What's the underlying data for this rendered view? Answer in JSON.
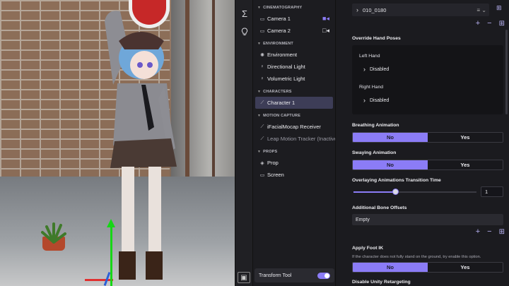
{
  "hierarchy": {
    "sections": [
      {
        "title": "CINEMATOGRAPHY",
        "items": [
          {
            "label": "Camera 1",
            "icon": "camera-icon",
            "right_icon": "video-active-icon"
          },
          {
            "label": "Camera 2",
            "icon": "camera-icon",
            "right_icon": "video-inactive-icon"
          }
        ]
      },
      {
        "title": "ENVIRONMENT",
        "items": [
          {
            "label": "Environment",
            "icon": "gear-icon"
          },
          {
            "label": "Directional Light",
            "icon": "bulb-icon"
          },
          {
            "label": "Volumetric Light",
            "icon": "bulb-icon"
          }
        ]
      },
      {
        "title": "CHARACTERS",
        "items": [
          {
            "label": "Character 1",
            "icon": "person-icon",
            "selected": true
          }
        ]
      },
      {
        "title": "MOTION CAPTURE",
        "items": [
          {
            "label": "iFacialMocap Receiver",
            "icon": "mocap-icon"
          },
          {
            "label": "Leap Motion Tracker (Inactive)",
            "icon": "mocap-icon",
            "dim": true
          }
        ]
      },
      {
        "title": "PROPS",
        "items": [
          {
            "label": "Prop",
            "icon": "cube-icon"
          },
          {
            "label": "Screen",
            "icon": "screen-icon"
          }
        ]
      }
    ],
    "transform_tool": {
      "label": "Transform Tool",
      "enabled": true
    }
  },
  "inspector": {
    "top_value": "010_0180",
    "override_hand_poses": {
      "label": "Override Hand Poses",
      "left_label": "Left Hand",
      "left_value": "Disabled",
      "right_label": "Right Hand",
      "right_value": "Disabled"
    },
    "breathing": {
      "label": "Breathing Animation",
      "options": [
        "No",
        "Yes"
      ],
      "selected": "No"
    },
    "swaying": {
      "label": "Swaying Animation",
      "options": [
        "No",
        "Yes"
      ],
      "selected": "No"
    },
    "transition": {
      "label": "Overlaying Animations Transition Time",
      "value": "1",
      "slider_fraction": 0.34
    },
    "bone_offsets": {
      "label": "Additional Bone Offsets",
      "value": "Empty"
    },
    "foot_ik": {
      "label": "Apply Foot IK",
      "note": "If the character does not fully stand on the ground, try enable this option.",
      "options": [
        "No",
        "Yes"
      ],
      "selected": "No"
    },
    "retargeting": {
      "label": "Disable Unity Retargeting"
    }
  },
  "colors": {
    "accent": "#8b7cf6",
    "panel": "#1b1b1f",
    "selected": "#3d3d57"
  }
}
